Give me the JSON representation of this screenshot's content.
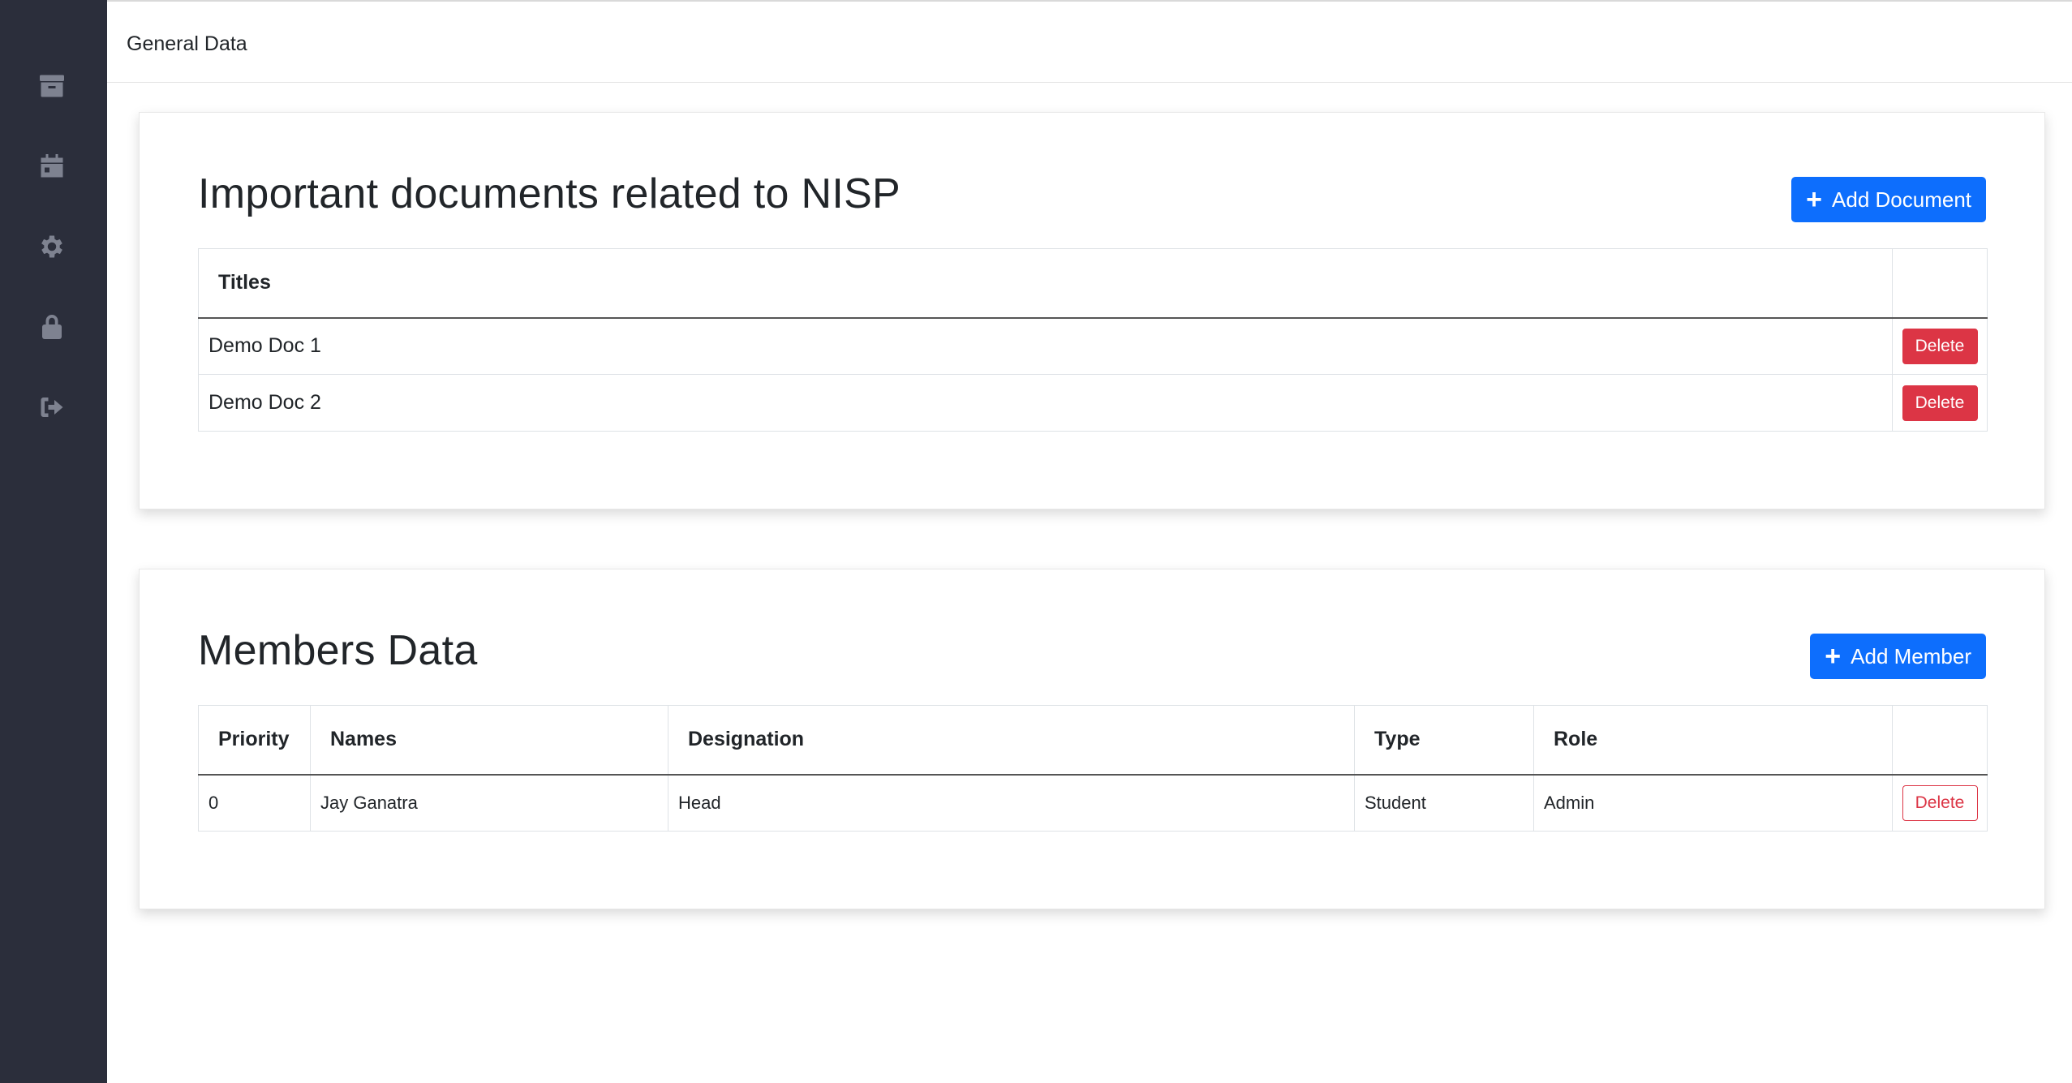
{
  "sidebar": {
    "icons": [
      "archive-icon",
      "calendar-icon",
      "gear-icon",
      "lock-icon",
      "sign-out-icon"
    ]
  },
  "topbar": {
    "title": "General Data"
  },
  "documents": {
    "title": "Important documents related to NISP",
    "add_button_label": "Add Document",
    "columns": [
      "Titles",
      ""
    ],
    "rows": [
      {
        "title": "Demo Doc 1",
        "action": "Delete"
      },
      {
        "title": "Demo Doc 2",
        "action": "Delete"
      }
    ]
  },
  "members": {
    "title": "Members Data",
    "add_button_label": "Add Member",
    "columns": [
      "Priority",
      "Names",
      "Designation",
      "Type",
      "Role",
      ""
    ],
    "rows": [
      {
        "priority": "0",
        "name": "Jay Ganatra",
        "designation": "Head",
        "type": "Student",
        "role": "Admin",
        "action": "Delete"
      }
    ]
  },
  "colors": {
    "sidebar_bg": "#2b2e3b",
    "primary": "#0d6efd",
    "danger": "#dc3545"
  }
}
